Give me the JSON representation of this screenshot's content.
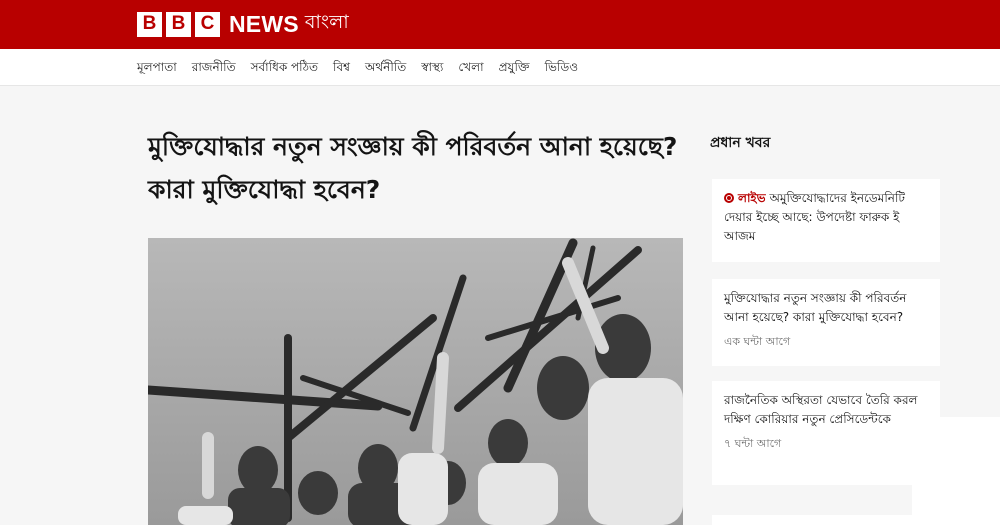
{
  "header": {
    "logo_letters": [
      "B",
      "B",
      "C"
    ],
    "news": "NEWS",
    "language": "বাংলা",
    "brand_color": "#b80000"
  },
  "nav": {
    "items": [
      "মূলপাতা",
      "রাজনীতি",
      "সর্বাধিক পঠিত",
      "বিশ্ব",
      "অর্থনীতি",
      "স্বাস্থ্য",
      "খেলা",
      "প্রযুক্তি",
      "ভিডিও"
    ]
  },
  "article": {
    "headline": "মুক্তিযোদ্ধার নতুন সংজ্ঞায় কী পরিবর্তন আনা হয়েছে? কারা মুক্তিযোদ্ধা হবেন?"
  },
  "sidebar": {
    "title": "প্রধান খবর",
    "items": [
      {
        "live_label": "লাইভ",
        "text": "অমুক্তিযোদ্ধাদের ইনডেমনিটি দেয়ার ইচ্ছে আছে: উপদেষ্টা ফারুক ই আজম"
      },
      {
        "text": "মুক্তিযোদ্ধার নতুন সংজ্ঞায় কী পরিবর্তন আনা হয়েছে? কারা মুক্তিযোদ্ধা হবেন?",
        "time": "এক ঘন্টা আগে"
      },
      {
        "text": "রাজনৈতিক অস্থিরতা যেভাবে তৈরি করল দক্ষিণ কোরিয়ার নতুন প্রেসিডেন্টকে",
        "time": "৭ ঘন্টা আগে"
      }
    ]
  }
}
